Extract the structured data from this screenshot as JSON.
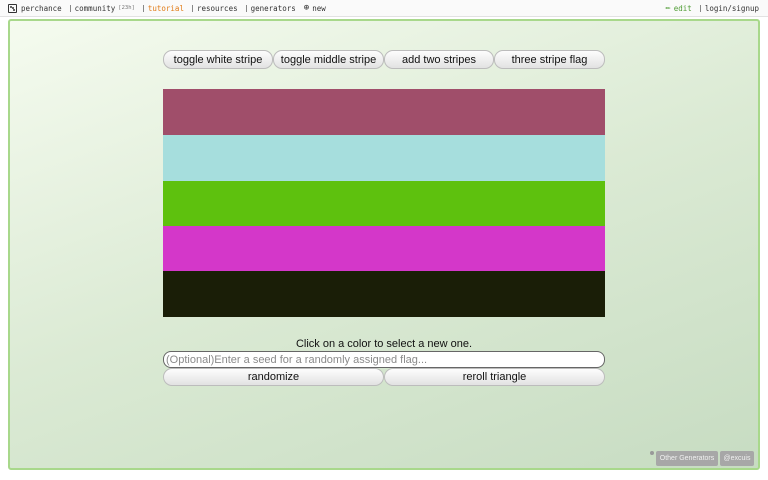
{
  "topbar": {
    "brand": "perchance",
    "community": "community",
    "community_count": "[23h]",
    "tutorial": "tutorial",
    "resources": "resources",
    "generators": "generators",
    "new": "new",
    "edit": "edit",
    "login": "login/signup"
  },
  "buttons": {
    "toggle_white": "toggle white stripe",
    "toggle_middle": "toggle middle stripe",
    "add_two": "add two stripes",
    "three_stripe": "three stripe flag",
    "randomize": "randomize",
    "reroll": "reroll triangle"
  },
  "flag": {
    "stripes": [
      "#a04e6a",
      "#a6dedd",
      "#5ec10e",
      "#d437c9",
      "#1a1e07"
    ]
  },
  "instruction": "Click on a color to select a new one.",
  "seed_input": {
    "placeholder": "(Optional)Enter a seed for a randomly assigned flag...",
    "value": ""
  },
  "footer": {
    "other_generators": "Other Generators",
    "author": "@excuis"
  },
  "colors": {
    "frame_border": "#a8d88b",
    "tutorial": "#e07b17",
    "edit": "#4f9c34"
  }
}
